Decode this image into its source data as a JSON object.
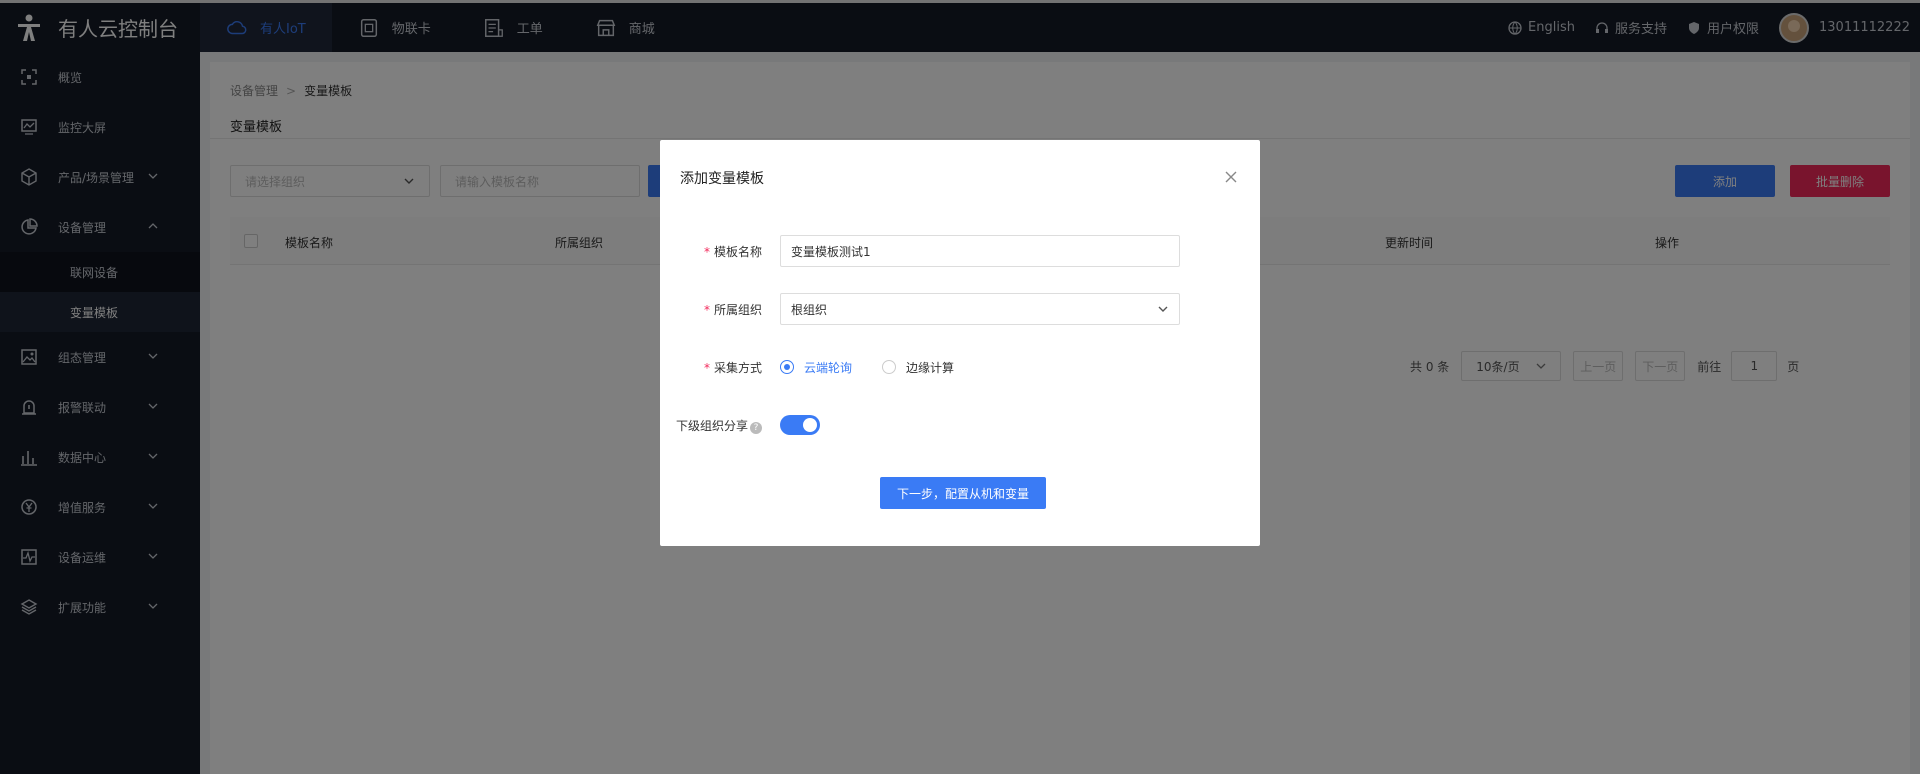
{
  "topbar": {
    "brand": "有人云控制台",
    "nav": [
      "有人IoT",
      "物联卡",
      "工单",
      "商城"
    ],
    "right": {
      "language": "English",
      "support": "服务支持",
      "permission": "用户权限",
      "user": "13011112222"
    }
  },
  "sidebar": {
    "items": [
      "概览",
      "监控大屏",
      "产品/场景管理",
      "设备管理",
      "组态管理",
      "报警联动",
      "数据中心",
      "增值服务",
      "设备运维",
      "扩展功能"
    ],
    "sub": [
      "联网设备",
      "变量模板"
    ]
  },
  "main": {
    "breadcrumb": [
      "设备管理",
      "变量模板"
    ],
    "title": "变量模板",
    "filter_select_placeholder": "请选择组织",
    "filter_input_placeholder": "请输入模板名称",
    "add_label": "添加",
    "batch_delete_label": "批量删除",
    "columns": [
      "模板名称",
      "所属组织",
      "更新时间",
      "操作"
    ],
    "pager": {
      "total": "共 0 条",
      "size": "10条/页",
      "prev": "上一页",
      "next": "下一页",
      "goto": "前往",
      "page": "1",
      "page_unit": "页"
    }
  },
  "modal": {
    "title": "添加变量模板",
    "name_label": "模板名称",
    "name_value": "变量模板测试1",
    "org_label": "所属组织",
    "org_value": "根组织",
    "method_label": "采集方式",
    "method_options": [
      "云端轮询",
      "边缘计算"
    ],
    "share_label": "下级组织分享",
    "next_label": "下一步，配置从机和变量"
  }
}
